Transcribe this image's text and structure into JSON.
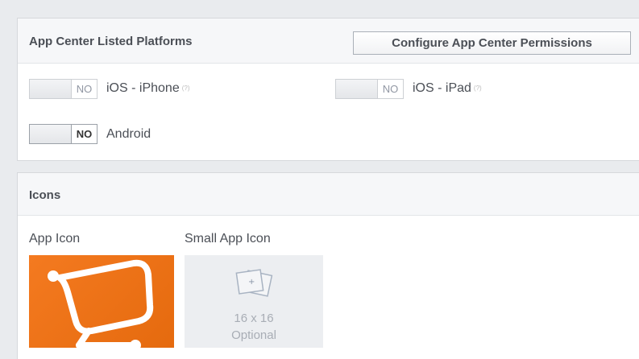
{
  "platforms_panel": {
    "title": "App Center Listed Platforms",
    "configure_button_label": "Configure App Center Permissions",
    "items": [
      {
        "toggle": "NO",
        "label": "iOS - iPhone",
        "note": "(?)"
      },
      {
        "toggle": "NO",
        "label": "iOS - iPad",
        "note": "(?)"
      },
      {
        "toggle": "NO",
        "label": "Android"
      }
    ]
  },
  "icons_panel": {
    "title": "Icons",
    "app_icon_label": "App Icon",
    "small_app_icon_label": "Small App Icon",
    "small_icon_size": "16 x 16",
    "small_icon_optional": "Optional"
  },
  "colors": {
    "app_icon_bg": "#f47a20",
    "page_bg": "#e9ebee"
  },
  "icons": [
    "app-center-logo-icon",
    "image-placeholder-icon"
  ]
}
